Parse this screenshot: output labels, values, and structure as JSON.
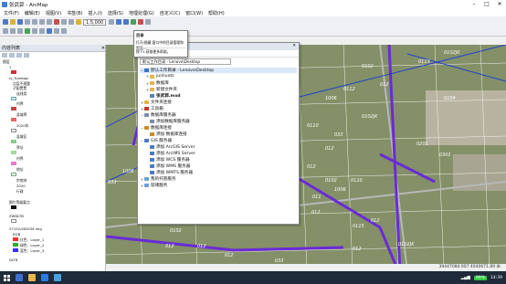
{
  "window": {
    "title": "张武郭 - ArcMap"
  },
  "menu": [
    "文件(F)",
    "编辑(E)",
    "视图(V)",
    "书签(B)",
    "插入(I)",
    "选择(S)",
    "地理处理(G)",
    "自定义(C)",
    "窗口(W)",
    "帮助(H)"
  ],
  "toolbar": {
    "scale": "1:5,000"
  },
  "toc": {
    "title": "内容列表",
    "items": [
      "图层",
      "1",
      "nj_Tuanbgz",
      "点层不规整",
      "子配置置",
      "连线类",
      "村界",
      "县域界",
      "2020年",
      "县域区",
      "界址",
      "村界",
      "地址",
      "宗地块",
      "2020",
      "行政",
      "图片等级要点",
      "ZWDLTB",
      "37152/4SDOM.img",
      "RGB",
      "红色：Layer_1",
      "绿色：Layer_2",
      "蓝色：Layer_3",
      "DLTB"
    ]
  },
  "catalog": {
    "title": "目录",
    "location": "默认工作目录 - Lenovo\\Desktop",
    "rows": [
      "默认工作目录 - Lenovo\\Desktop",
      "junliuotz",
      "数据库",
      "新建文件夹",
      "张武郭.mxd",
      "文件夹连接",
      "工具箱",
      "数据库服务器",
      "添加数据库服务器",
      "数据库连接",
      "添加 数据库连接",
      "GIS 服务器",
      "添加 ArcGIS Server",
      "添加 ArcIMS Server",
      "添加 WCS 服务器",
      "添加 WMS 服务器",
      "添加 WMTS 服务器",
      "我的托管服务",
      "就绪服务"
    ]
  },
  "tooltip": {
    "title": "目录",
    "body": "打开/隐藏 窗口中的目录管理和数据...",
    "footer": "按 F1 获取更多帮助。"
  },
  "map": {
    "labels": [
      "0102",
      "0113",
      "0112",
      "012",
      "1006",
      "0102JK",
      "0110",
      "033",
      "0201",
      "0301",
      "012",
      "012",
      "0102",
      "0110",
      "011",
      "012",
      "012",
      "1006",
      "012",
      "012",
      "0302",
      "012",
      "1006",
      "012",
      "0102JK",
      "033",
      "0102JK",
      "0102",
      "012",
      "1006",
      "0201",
      "033",
      "012",
      "0104",
      "0115",
      "012"
    ]
  },
  "status": {
    "coordinates": "39447084.907  4040671.89 米"
  },
  "taskbar": {
    "battery": "99%",
    "time": "14:39"
  },
  "colors": {
    "boundary": "#6a2bd6",
    "road": "#1f3fd6"
  }
}
